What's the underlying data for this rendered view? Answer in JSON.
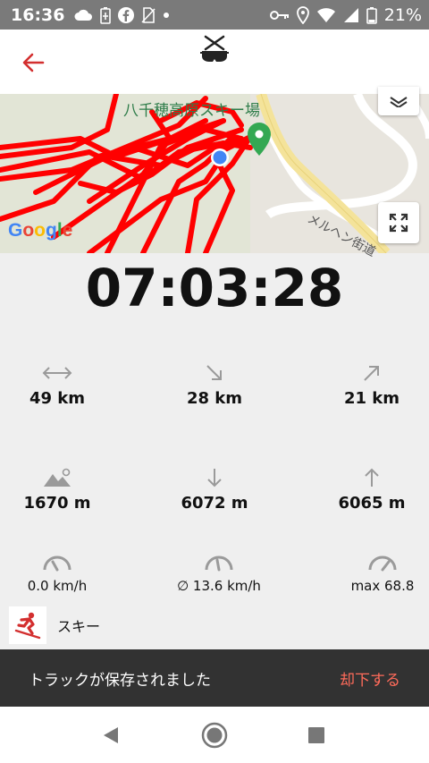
{
  "status_bar": {
    "time": "16:36",
    "battery_percent": "21%",
    "left_icons": [
      "cloud-icon",
      "battery-saver-icon",
      "facebook-icon",
      "no-sim-icon",
      "dot-icon"
    ],
    "right_icons": [
      "vpn-key-icon",
      "location-icon",
      "wifi-icon",
      "signal-icon",
      "battery-icon"
    ]
  },
  "app_bar": {
    "back_icon": "arrow-left-icon",
    "logo_icon": "ski-goggles-logo-icon",
    "accent_color": "#d32f2f"
  },
  "map": {
    "place_label": "八千穂高原スキー場",
    "road_label": "メルヘン街道",
    "attribution": "Google",
    "track_color": "#ff0000",
    "pin_color": "#34a853",
    "location_dot_color": "#4285f4"
  },
  "tracking": {
    "elapsed_time": "07:03:28",
    "stats_row1": [
      {
        "icon": "horizontal-distance-icon",
        "value": "49 km"
      },
      {
        "icon": "downhill-arrow-icon",
        "value": "28 km"
      },
      {
        "icon": "uphill-arrow-icon",
        "value": "21 km"
      }
    ],
    "stats_row2": [
      {
        "icon": "mountain-altitude-icon",
        "value": "1670 m"
      },
      {
        "icon": "descent-arrow-icon",
        "value": "6072 m"
      },
      {
        "icon": "ascent-arrow-icon",
        "value": "6065 m"
      }
    ],
    "stats_row3": [
      {
        "icon": "speedometer-icon",
        "value": "0.0 km/h"
      },
      {
        "icon": "speedometer-icon",
        "value": "∅ 13.6 km/h"
      },
      {
        "icon": "speedometer-icon",
        "value": "max 68.8"
      }
    ]
  },
  "activity": {
    "icon": "skier-icon",
    "label": "スキー"
  },
  "snackbar": {
    "message": "トラックが保存されました",
    "action": "却下する"
  },
  "nav_bar": {
    "buttons": [
      "back-triangle-icon",
      "home-circle-icon",
      "recents-square-icon"
    ]
  }
}
